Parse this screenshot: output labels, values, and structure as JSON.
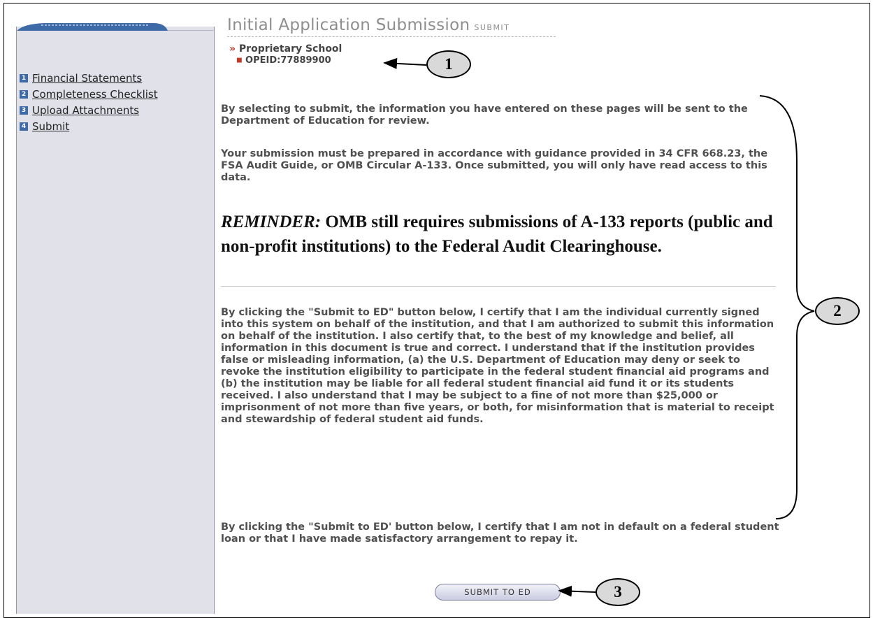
{
  "page": {
    "title": "Initial Application Submission",
    "title_sub": "SUBMIT",
    "school": "Proprietary School",
    "opeid": "OPEID:77889900"
  },
  "nav": {
    "items": [
      {
        "num": "1",
        "label": "Financial Statements"
      },
      {
        "num": "2",
        "label": "Completeness Checklist"
      },
      {
        "num": "3",
        "label": "Upload Attachments"
      },
      {
        "num": "4",
        "label": "Submit"
      }
    ]
  },
  "content": {
    "para1": "By selecting to submit, the information you have entered on these pages will be sent to the Department of Education for review.",
    "para2": "Your submission must be prepared in accordance with guidance provided in 34 CFR 668.23, the FSA Audit Guide, or OMB Circular A-133. Once submitted, you will only have read access to this data.",
    "reminder_lead": "REMINDER:",
    "reminder_text": " OMB still requires submissions of A-133 reports (public and non-profit institutions) to the Federal Audit Clearinghouse.",
    "para3": "By clicking the \"Submit to ED\" button below, I certify that I am the individual currently signed into this system on behalf of the institution, and that I am authorized to submit this information on behalf of the institution. I also certify that, to the best of my knowledge and belief, all information in this document is true and correct. I understand that if the institution provides false or misleading information, (a) the U.S. Department of Education may deny or seek to revoke the institution eligibility to participate in the federal student financial aid programs and (b) the institution may be liable for all federal student financial aid fund it or its students received. I also understand that I may be subject to a fine of not more than $25,000 or imprisonment of not more than five years, or both, for misinformation that is material to receipt and stewardship of federal student aid funds.",
    "para4": "By clicking the \"Submit to ED' button below, I certify that I am not in default on a federal student loan or that I have made satisfactory arrangement to repay it."
  },
  "submit_label": "SUBMIT TO ED",
  "callouts": [
    "1",
    "2",
    "3"
  ],
  "colors": {
    "accent": "#3f6aa8",
    "sidebar": "#e1e1ea",
    "marker": "#c0392b"
  }
}
